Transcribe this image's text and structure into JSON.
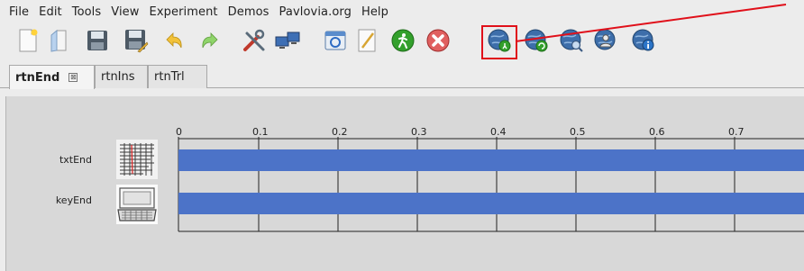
{
  "window": {
    "title": ""
  },
  "menubar": {
    "items": [
      "File",
      "Edit",
      "Tools",
      "View",
      "Experiment",
      "Demos",
      "Pavlovia.org",
      "Help"
    ]
  },
  "toolbar": {
    "buttons": [
      {
        "name": "new-file",
        "icon": "new-file-icon"
      },
      {
        "name": "open-file",
        "icon": "open-folder-icon"
      },
      {
        "name": "save",
        "icon": "save-icon"
      },
      {
        "name": "save-as",
        "icon": "save-as-icon"
      },
      {
        "name": "undo",
        "icon": "undo-icon"
      },
      {
        "name": "redo",
        "icon": "redo-icon"
      },
      {
        "name": "preferences",
        "icon": "tools-icon"
      },
      {
        "name": "monitor-center",
        "icon": "monitor-icon"
      },
      {
        "name": "experiment-settings",
        "icon": "settings-window-icon"
      },
      {
        "name": "compile-script",
        "icon": "script-icon"
      },
      {
        "name": "run",
        "icon": "run-icon"
      },
      {
        "name": "stop",
        "icon": "stop-icon"
      },
      {
        "name": "pavlovia-run",
        "icon": "globe-run-icon"
      },
      {
        "name": "pavlovia-sync",
        "icon": "globe-sync-icon"
      },
      {
        "name": "pavlovia-search",
        "icon": "globe-search-icon"
      },
      {
        "name": "pavlovia-user",
        "icon": "globe-user-icon"
      },
      {
        "name": "pavlovia-info",
        "icon": "globe-info-icon"
      }
    ],
    "highlight_color": "#e0101a"
  },
  "tabs": [
    {
      "label": "rtnEnd",
      "active": true,
      "close": "⊠"
    },
    {
      "label": "rtnIns",
      "active": false
    },
    {
      "label": "rtnTrl",
      "active": false
    }
  ],
  "timeline": {
    "ticks": [
      "0",
      "0.1",
      "0.2",
      "0.3",
      "0.4",
      "0.5",
      "0.6",
      "0.7"
    ],
    "bar_color": "#4c73c8",
    "components": [
      {
        "label": "txtEnd",
        "icon": "text-component-icon"
      },
      {
        "label": "keyEnd",
        "icon": "keyboard-component-icon"
      }
    ]
  }
}
